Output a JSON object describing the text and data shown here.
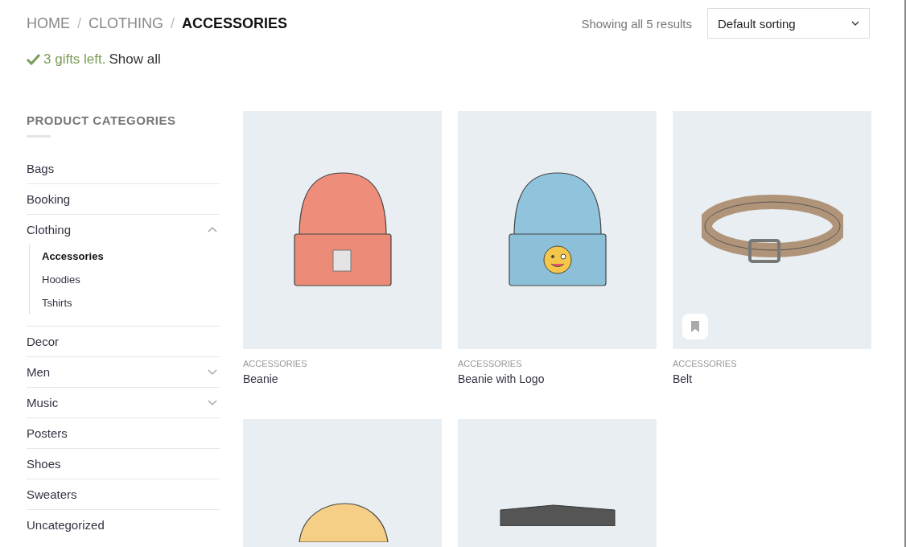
{
  "breadcrumb": [
    {
      "label": "HOME",
      "selected": false
    },
    {
      "label": "CLOTHING",
      "selected": false
    },
    {
      "label": "ACCESSORIES",
      "selected": true
    }
  ],
  "breadcrumb_separator": "/",
  "notice": {
    "message": "3 gifts left.",
    "link": "Show all"
  },
  "result_count": "Showing all 5 results",
  "sorting": {
    "value": "Default sorting"
  },
  "sidebar": {
    "title": "PRODUCT CATEGORIES",
    "items": [
      {
        "label": "Bags"
      },
      {
        "label": "Booking"
      },
      {
        "label": "Clothing",
        "expanded": true,
        "children": [
          {
            "label": "Accessories",
            "selected": true
          },
          {
            "label": "Hoodies",
            "selected": false
          },
          {
            "label": "Tshirts",
            "selected": false
          }
        ]
      },
      {
        "label": "Decor"
      },
      {
        "label": "Men",
        "expanded": false
      },
      {
        "label": "Music",
        "expanded": false
      },
      {
        "label": "Posters"
      },
      {
        "label": "Shoes"
      },
      {
        "label": "Sweaters"
      },
      {
        "label": "Uncategorized"
      }
    ]
  },
  "products": [
    {
      "kind": "beanie",
      "category": "ACCESSORIES",
      "name": "Beanie",
      "wishlist": false
    },
    {
      "kind": "beanie-logo",
      "category": "ACCESSORIES",
      "name": "Beanie with Logo",
      "wishlist": false
    },
    {
      "kind": "belt",
      "category": "ACCESSORIES",
      "name": "Belt",
      "wishlist": true
    },
    {
      "kind": "cap"
    },
    {
      "kind": "sunglasses"
    }
  ]
}
